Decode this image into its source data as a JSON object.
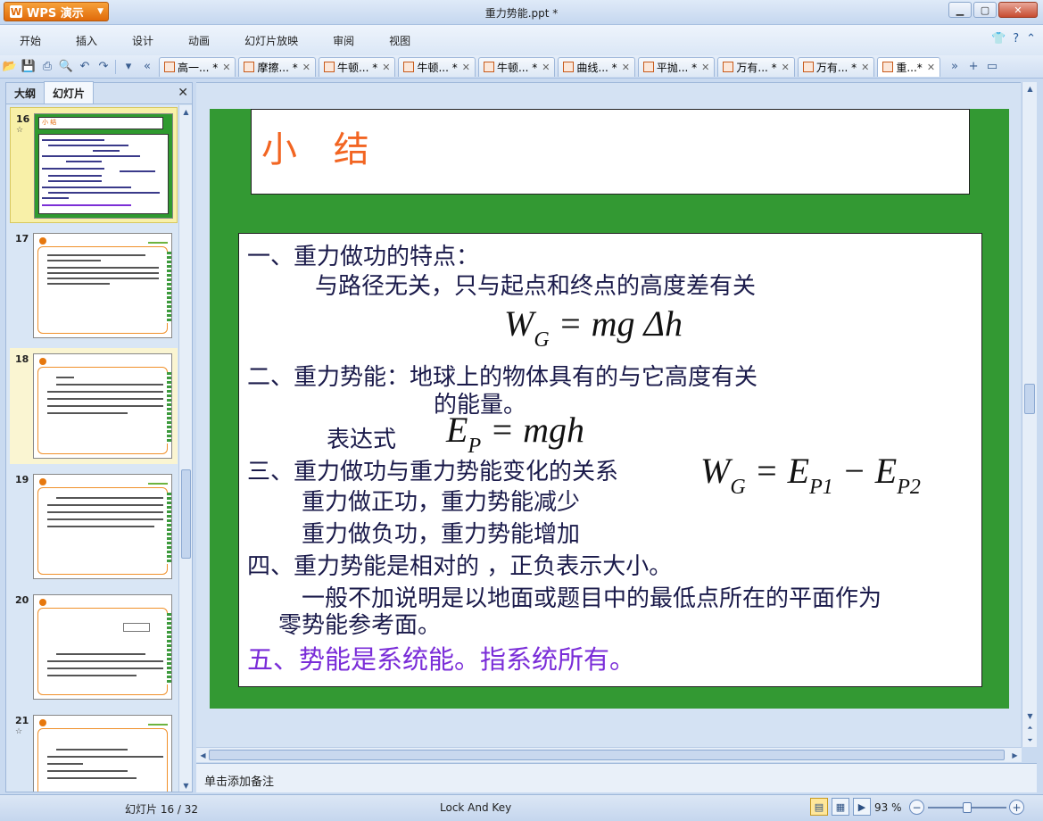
{
  "app": {
    "name": "WPS 演示",
    "window_title": "重力势能.ppt *"
  },
  "menu": [
    "开始",
    "插入",
    "设计",
    "动画",
    "幻灯片放映",
    "审阅",
    "视图"
  ],
  "tabs": [
    {
      "label": "高一... *"
    },
    {
      "label": "摩擦... *"
    },
    {
      "label": "牛顿... *"
    },
    {
      "label": "牛顿... *"
    },
    {
      "label": "牛顿... *"
    },
    {
      "label": "曲线... *"
    },
    {
      "label": "平抛... *"
    },
    {
      "label": "万有... *"
    },
    {
      "label": "万有... *"
    },
    {
      "label": "重...*",
      "active": true
    }
  ],
  "left_panel": {
    "tab_outline": "大纲",
    "tab_slides": "幻灯片",
    "thumbnails": [
      {
        "number": "16",
        "has_transition": true,
        "selected": true,
        "title": "小 结"
      },
      {
        "number": "17",
        "has_transition": false,
        "selected": false
      },
      {
        "number": "18",
        "has_transition": false,
        "selected": false
      },
      {
        "number": "19",
        "has_transition": false,
        "selected": false
      },
      {
        "number": "20",
        "has_transition": false,
        "selected": false
      },
      {
        "number": "21",
        "has_transition": true,
        "selected": false
      }
    ]
  },
  "slide": {
    "title": "小  结",
    "lines": {
      "l1": "一、重力做功的特点：",
      "l2": "与路径无关，只与起点和终点的高度差有关",
      "l3a": "二、重力势能：地球上的物体具有的与它高度有关",
      "l3b": "的能量。",
      "l4": "表达式",
      "l5": "三、重力做功与重力势能变化的关系",
      "l6": "重力做正功，重力势能减少",
      "l7": "重力做负功，重力势能增加",
      "l8": "四、重力势能是相对的 ，正负表示大小。",
      "l9a": "一般不加说明是以地面或题目中的最低点所在的平面作为",
      "l9b": "零势能参考面。",
      "l10": "五、势能是系统能。指系统所有。"
    },
    "formulas": {
      "f1_lhs": "W",
      "f1_lhs_sub": "G",
      "f1_rhs": "= mg Δh",
      "f2_lhs": "E",
      "f2_lhs_sub": "P",
      "f2_rhs": "= mgh",
      "f3_lhs": "W",
      "f3_lhs_sub": "G",
      "f3_eq": "= E",
      "f3_sub1": "P1",
      "f3_minus": "− E",
      "f3_sub2": "P2"
    }
  },
  "notes_placeholder": "单击添加备注",
  "status": {
    "slide_position": "幻灯片 16 / 32",
    "theme": "Lock And Key",
    "zoom": "93 %",
    "zoom_fraction": 0.5
  }
}
